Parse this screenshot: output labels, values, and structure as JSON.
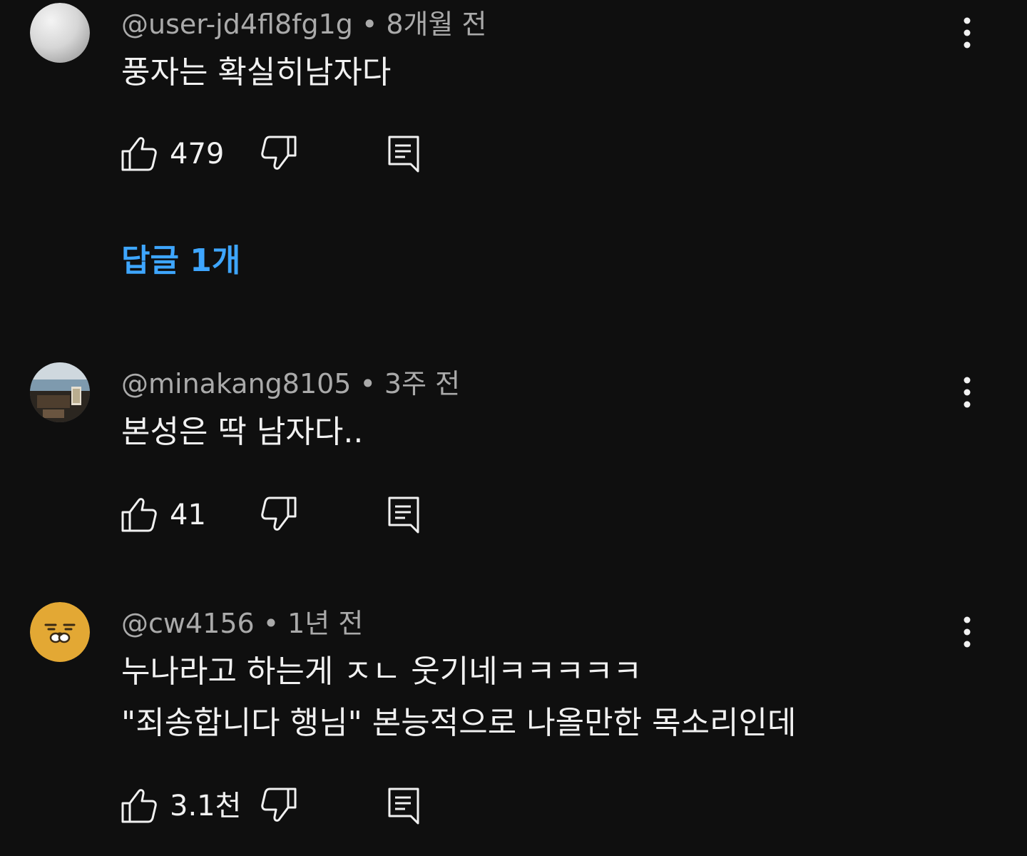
{
  "colors": {
    "background": "#0f0f0f",
    "primary_text": "#f1f1f1",
    "secondary_text": "#aaaaaa",
    "link": "#3ea6ff"
  },
  "comments": [
    {
      "author": "@user-jd4fl8fg1g",
      "time": "8개월 전",
      "text": [
        "풍자는 확실히남자다"
      ],
      "likes": "479",
      "replies_label": "답글 1개",
      "avatar": "gray-default-avatar"
    },
    {
      "author": "@minakang8105",
      "time": "3주 전",
      "text": [
        "본성은 딱 남자다.."
      ],
      "likes": "41",
      "avatar": "photo-avatar"
    },
    {
      "author": "@cw4156",
      "time": "1년 전",
      "text": [
        "누나라고 하는게 ㅈㄴ 웃기네ㅋㅋㅋㅋㅋ",
        "\"죄송합니다 행님\" 본능적으로 나올만한 목소리인데"
      ],
      "likes": "3.1천",
      "avatar": "yellow-character-avatar"
    }
  ],
  "icons": {
    "like": "thumbs-up-icon",
    "dislike": "thumbs-down-icon",
    "reply": "reply-comment-icon",
    "more": "more-vertical-icon"
  },
  "separator": "•"
}
